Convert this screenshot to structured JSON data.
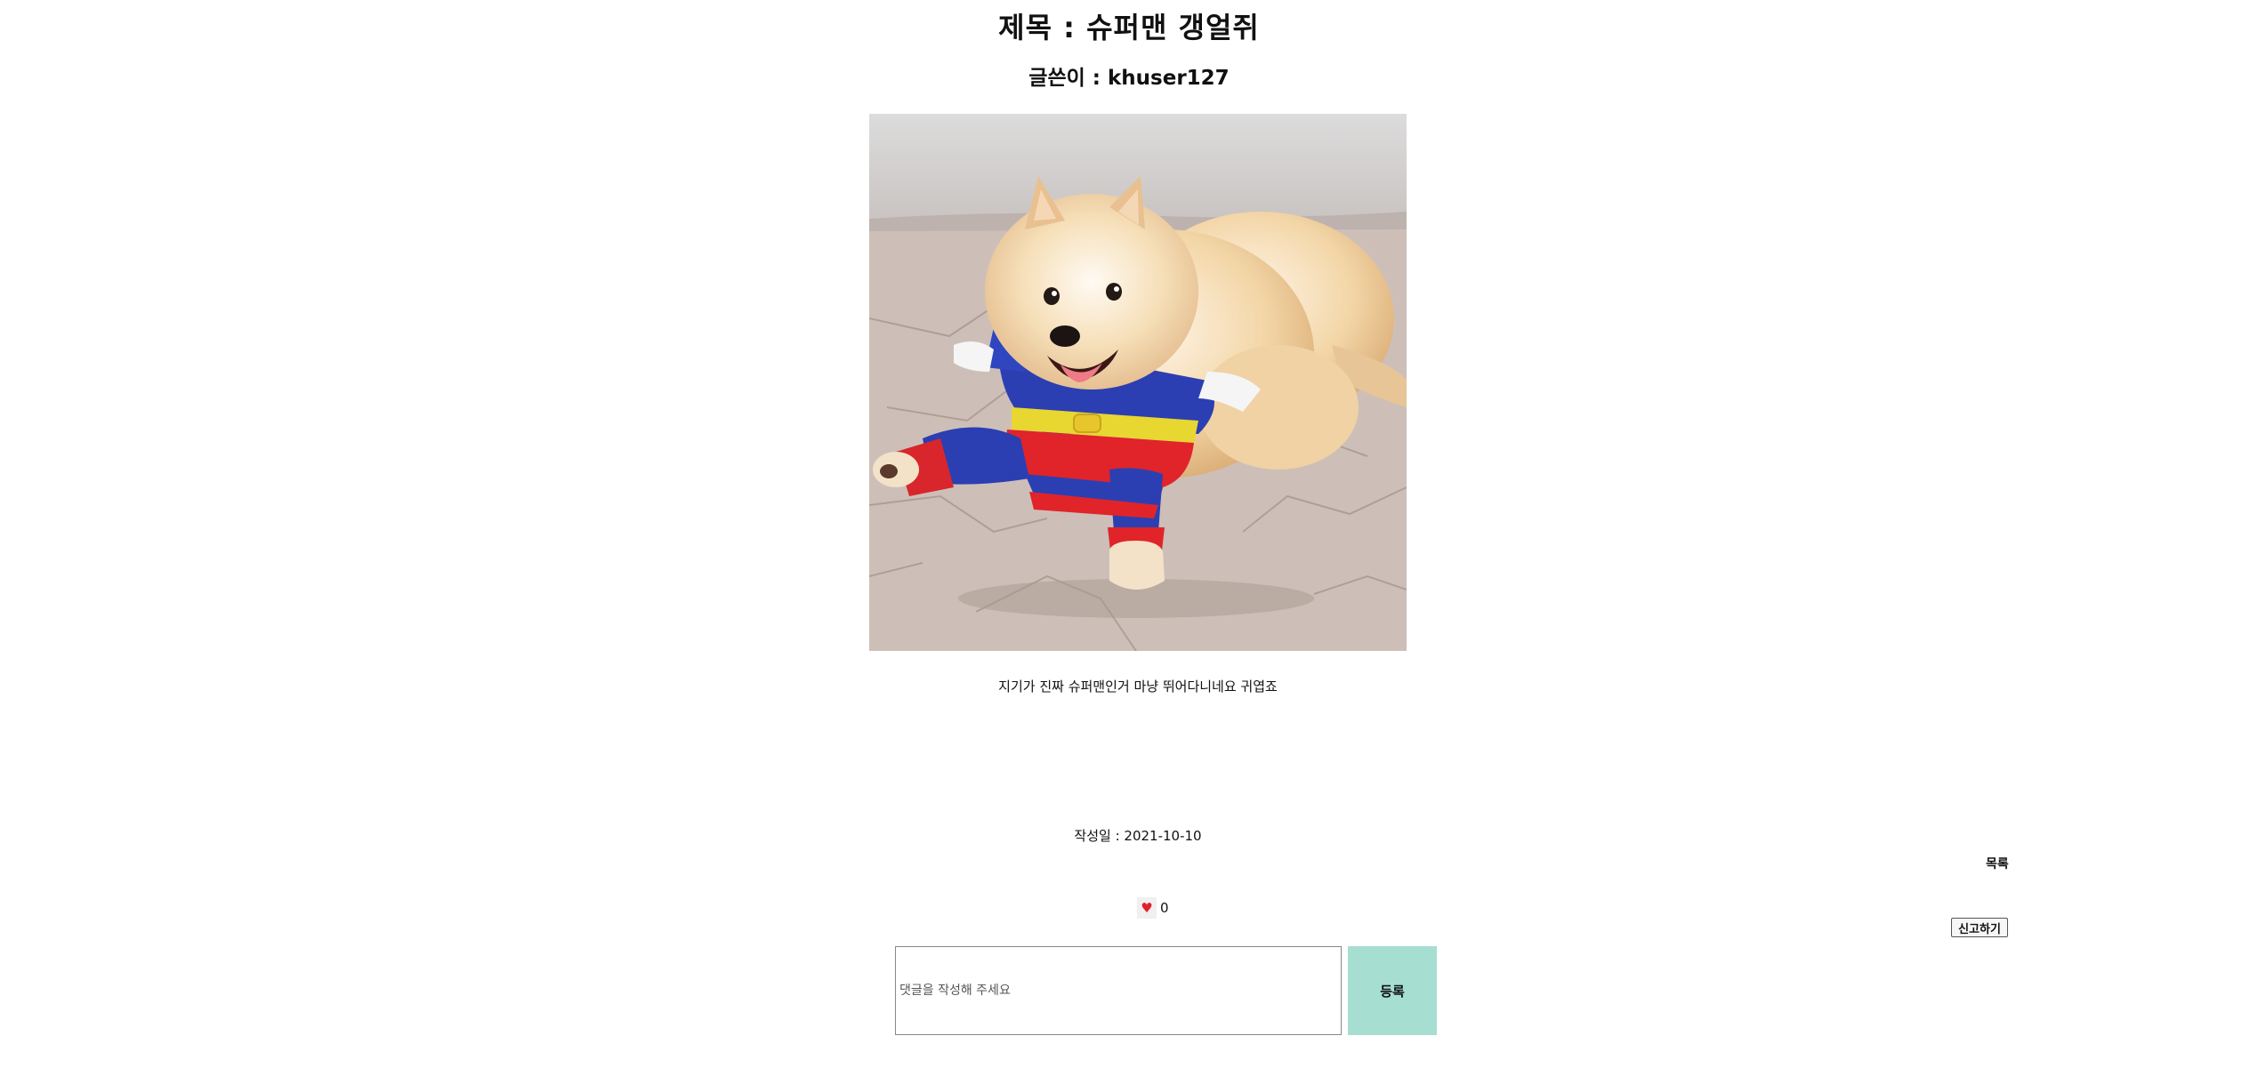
{
  "post": {
    "title": "제목 : 슈퍼맨 갱얼쥐",
    "author": "글쓴이 : khuser127",
    "image_alt": "superman-costume-pomeranian",
    "content": "지기가 진짜 슈퍼맨인거 마냥 뛰어다니네요 귀엽죠",
    "date": "작성일 : 2021-10-10"
  },
  "nav": {
    "list_label": "목록"
  },
  "likes": {
    "icon": "heart-icon",
    "heart_glyph": "♥",
    "count": "0"
  },
  "report": {
    "label": "신고하기"
  },
  "comment": {
    "placeholder": "댓글을 작성해 주세요",
    "value": "",
    "submit_label": "등록"
  },
  "colors": {
    "submit_bg": "#a6ded2",
    "heart": "#e0202a"
  }
}
